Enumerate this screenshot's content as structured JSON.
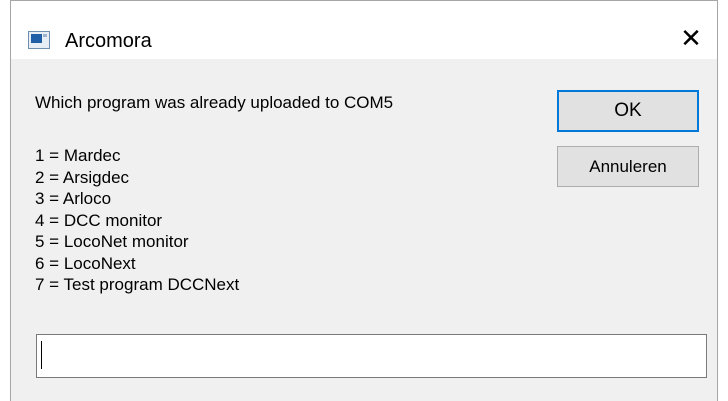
{
  "dialog": {
    "title": "Arcomora",
    "close_glyph": "✕",
    "app_icon": "window-app-icon",
    "message": "Which program was already uploaded to COM5",
    "options": [
      "1 = Mardec",
      "2 = Arsigdec",
      "3 = Arloco",
      "4 = DCC monitor",
      "5 = LocoNet monitor",
      "6 = LocoNext",
      "7 = Test program DCCNext"
    ],
    "ok_label": "OK",
    "cancel_label": "Annuleren",
    "input_value": "",
    "accent_color": "#0078d7"
  }
}
